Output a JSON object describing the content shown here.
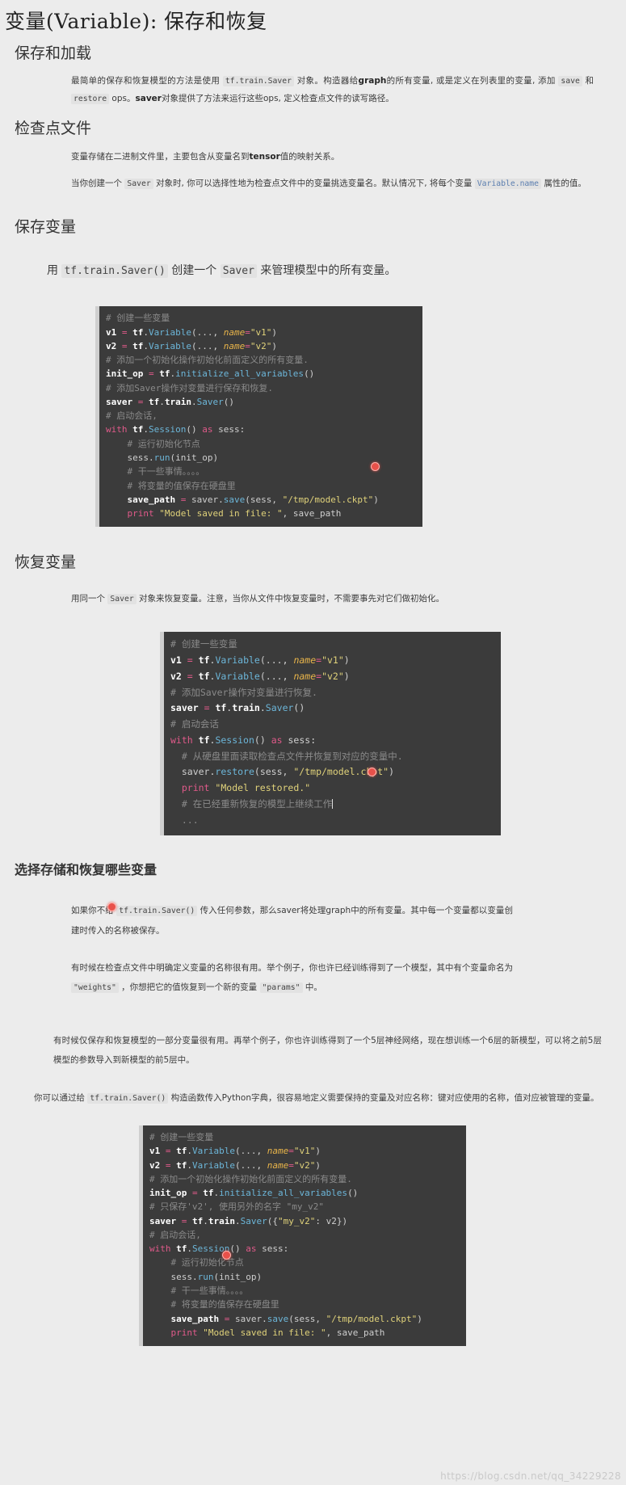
{
  "article": {
    "title": "变量(Variable): 保存和恢复",
    "sections": {
      "save_load_heading": "保存和加载",
      "save_load_p1_a": "最简单的保存和恢复模型的方法是使用 ",
      "save_load_p1_code1": "tf.train.Saver",
      "save_load_p1_b": " 对象。构造器给",
      "save_load_p1_bold1": "graph",
      "save_load_p1_c": "的所有变量, 或是定义在列表里的变量, 添加 ",
      "save_load_p1_code2": "save",
      "save_load_p1_d": " 和 ",
      "save_load_p1_code3": "restore",
      "save_load_p1_e": " ops。",
      "save_load_p1_bold2": "saver",
      "save_load_p1_f": "对象提供了方法来运行这些ops, 定义检查点文件的读写路径。",
      "checkpoint_heading": "检查点文件",
      "checkpoint_p1_a": "变量存储在二进制文件里，主要包含从变量名到",
      "checkpoint_p1_bold": "tensor",
      "checkpoint_p1_b": "值的映射关系。",
      "checkpoint_p2_a": "当你创建一个 ",
      "checkpoint_p2_code1": "Saver",
      "checkpoint_p2_b": " 对象时, 你可以选择性地为检查点文件中的变量挑选变量名。默认情况下, 将每个变量 ",
      "checkpoint_p2_code2": "Variable.name",
      "checkpoint_p2_c": " 属性的值。",
      "save_var_heading": "保存变量",
      "save_var_p1_a": "用 ",
      "save_var_p1_code1": "tf.train.Saver()",
      "save_var_p1_b": " 创建一个 ",
      "save_var_p1_code2": "Saver",
      "save_var_p1_c": " 来管理模型中的所有变量。",
      "restore_var_heading": "恢复变量",
      "restore_var_p1_a": "用同一个 ",
      "restore_var_p1_code1": "Saver",
      "restore_var_p1_b": " 对象来恢复变量。注意，当你从文件中恢复变量时，不需要事先对它们做初始化。",
      "choose_heading": "选择存储和恢复哪些变量",
      "choose_p1_a": "如果你不给 ",
      "choose_p1_code1": "tf.train.Saver()",
      "choose_p1_b": " 传入任何参数，那么saver将处理graph中的所有变量。其中每一个变量都以变量创建时传入的名称被保存。",
      "choose_p2_a": "有时候在检查点文件中明确定义变量的名称很有用。举个例子，你也许已经训练得到了一个模型，其中有个变量命名为 ",
      "choose_p2_code1": "\"weights\"",
      "choose_p2_b": " ，你想把它的值恢复到一个新的变量 ",
      "choose_p2_code2": "\"params\"",
      "choose_p2_c": " 中。",
      "choose_p3": "有时候仅保存和恢复模型的一部分变量很有用。再举个例子，你也许训练得到了一个5层神经网络，现在想训练一个6层的新模型，可以将之前5层模型的参数导入到新模型的前5层中。",
      "choose_p4_a": "你可以通过给 ",
      "choose_p4_code1": "tf.train.Saver()",
      "choose_p4_b": " 构造函数传入Python字典，很容易地定义需要保持的变量及对应名称：键对应使用的名称，值对应被管理的变量。"
    },
    "code_blocks": {
      "save_variables": [
        "# 创建一些变量",
        "v1 = tf.Variable(..., name=\"v1\")",
        "v2 = tf.Variable(..., name=\"v2\")",
        "# 添加一个初始化操作初始化前面定义的所有变量.",
        "init_op = tf.initialize_all_variables()",
        "# 添加Saver操作对变量进行保存和恢复.",
        "saver = tf.train.Saver()",
        "# 启动会话,",
        "with tf.Session() as sess:",
        "    # 运行初始化节点",
        "    sess.run(init_op)",
        "    # 干一些事情。。。。",
        "    # 将变量的值保存在硬盘里",
        "    save_path = saver.save(sess, \"/tmp/model.ckpt\")",
        "    print \"Model saved in file: \", save_path"
      ],
      "restore_variables": [
        "# 创建一些变量",
        "v1 = tf.Variable(..., name=\"v1\")",
        "v2 = tf.Variable(..., name=\"v2\")",
        "# 添加Saver操作对变量进行恢复.",
        "saver = tf.train.Saver()",
        "# 启动会话",
        "with tf.Session() as sess:",
        "  # 从硬盘里面读取检查点文件并恢复到对应的变量中.",
        "  saver.restore(sess, \"/tmp/model.ckpt\")",
        "  print \"Model restored.\"",
        "  # 在已经重新恢复的模型上继续工作",
        "  ..."
      ],
      "choose_variables": [
        "# 创建一些变量",
        "v1 = tf.Variable(..., name=\"v1\")",
        "v2 = tf.Variable(..., name=\"v2\")",
        "# 添加一个初始化操作初始化前面定义的所有变量.",
        "init_op = tf.initialize_all_variables()",
        "# 只保存'v2', 使用另外的名字 \"my_v2\"",
        "saver = tf.train.Saver({\"my_v2\": v2})",
        "# 启动会话,",
        "with tf.Session() as sess:",
        "    # 运行初始化节点",
        "    sess.run(init_op)",
        "    # 干一些事情。。。。",
        "    # 将变量的值保存在硬盘里",
        "    save_path = saver.save(sess, \"/tmp/model.ckpt\")",
        "    print \"Model saved in file: \", save_path"
      ]
    },
    "watermark": "https://blog.csdn.net/qq_34229228"
  }
}
